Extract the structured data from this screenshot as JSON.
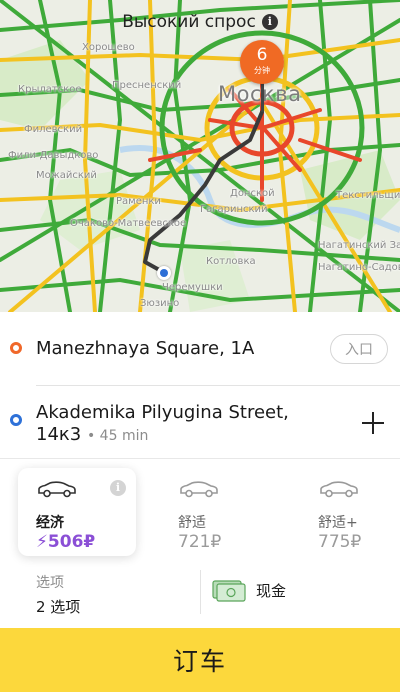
{
  "map": {
    "surge_title": "Высокий спрос",
    "city": "Москва",
    "eta_minutes": "6",
    "eta_unit": "分钟",
    "labels": [
      "Хорошево",
      "Пресненский",
      "Крылатское",
      "Филевский",
      "Фили-Давыдково",
      "Можайский",
      "Раменки",
      "Очаково-Матвеевское",
      "Гагаринский",
      "Донской",
      "Котловка",
      "Черемушки",
      "Нагатинский Затон",
      "Нагатино-Садовники",
      "Текстильщики",
      "Зюзино"
    ]
  },
  "route": {
    "from_address": "Manezhnaya Square, 1A",
    "entrance_button": "入口",
    "to_address": "Akademika Pilyugina Street, 14к3",
    "to_eta": "• 45 min"
  },
  "tariffs": [
    {
      "name": "经济",
      "price": "⚡506₽",
      "selected": true,
      "icon": "car-economy-icon"
    },
    {
      "name": "舒适",
      "price": "721₽",
      "selected": false,
      "icon": "car-comfort-icon"
    },
    {
      "name": "舒适+",
      "price": "775₽",
      "selected": false,
      "icon": "car-comfort-plus-icon"
    }
  ],
  "options": {
    "label": "选项",
    "value": "2 选项"
  },
  "payment": {
    "label": "现金",
    "icon": "cash-icon"
  },
  "order_button": "订车",
  "colors": {
    "accent_yellow": "#fcd83c",
    "surge_purple": "#8b4fd6",
    "eta_orange": "#f06a24",
    "traffic_green": "#4caf50",
    "traffic_yellow": "#f5c526",
    "traffic_red": "#e8472b"
  }
}
